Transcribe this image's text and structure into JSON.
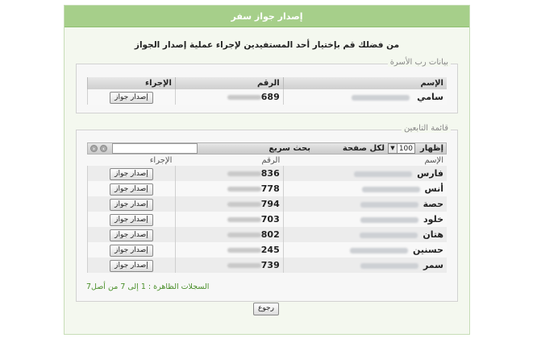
{
  "panel": {
    "title": "إصدار جواز سفر",
    "instruction": "من فضلك قم بإختيار أحد المستفيدين لإجراء عملية إصدار الجواز"
  },
  "family_head": {
    "legend": "بيانات رب الأسرة",
    "columns": {
      "name": "الإسم",
      "number": "الرقم",
      "action": "الإجراء"
    },
    "row": {
      "name": "سامي",
      "number": "689",
      "action_label": "إصدار جواز"
    }
  },
  "dependents": {
    "legend": "قائمة التابعين",
    "toolbar": {
      "show_label": "إظهار",
      "page_size": "100",
      "per_page_label": "لكل صفحة",
      "search_label": "بحث سريع",
      "search_value": ""
    },
    "columns": {
      "name": "الإسم",
      "number": "الرقم",
      "action": "الإجراء"
    },
    "rows": [
      {
        "name": "فارس",
        "number": "836",
        "action_label": "إصدار جواز"
      },
      {
        "name": "أنس",
        "number": "778",
        "action_label": "إصدار جواز"
      },
      {
        "name": "حصة",
        "number": "794",
        "action_label": "إصدار جواز"
      },
      {
        "name": "خلود",
        "number": "703",
        "action_label": "إصدار جواز"
      },
      {
        "name": "هتان",
        "number": "802",
        "action_label": "إصدار جواز"
      },
      {
        "name": "حسنين",
        "number": "245",
        "action_label": "إصدار جواز"
      },
      {
        "name": "سمر",
        "number": "739",
        "action_label": "إصدار جواز"
      }
    ],
    "records_text": "السجلات الظاهرة : 1 إلى 7 من أصل7"
  },
  "back_label": "رجوع",
  "colors": {
    "header_green": "#a6cf8a",
    "records_green": "#4a8f2a"
  }
}
